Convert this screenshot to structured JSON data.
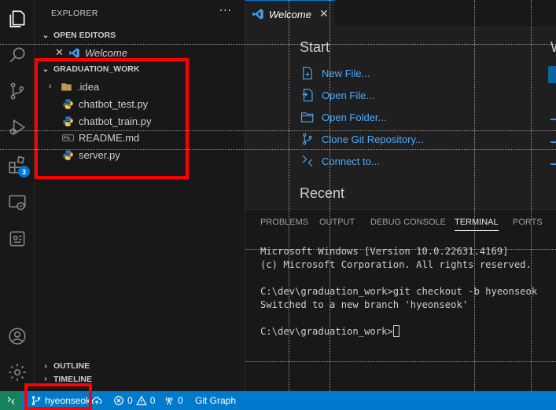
{
  "sidebar": {
    "header": "EXPLORER",
    "more": "···",
    "open_editors": {
      "title": "OPEN EDITORS",
      "items": [
        {
          "label": "Welcome",
          "icon": "vscode-icon"
        }
      ]
    },
    "folder": {
      "title": "GRADUATION_WORK",
      "items": [
        {
          "label": ".idea",
          "icon": "folder-icon"
        },
        {
          "label": "chatbot_test.py",
          "icon": "python-icon"
        },
        {
          "label": "chatbot_train.py",
          "icon": "python-icon"
        },
        {
          "label": "README.md",
          "icon": "markdown-icon"
        },
        {
          "label": "server.py",
          "icon": "python-icon"
        }
      ]
    },
    "outline_title": "OUTLINE",
    "timeline_title": "TIMELINE"
  },
  "activity_bar": {
    "items": [
      "explorer-icon",
      "search-icon",
      "source-control-icon",
      "run-debug-icon",
      "extensions-icon",
      "remote-explorer-icon",
      "copilot-icon"
    ],
    "extensions_badge": "3",
    "bottom": [
      "account-icon",
      "settings-gear-icon"
    ]
  },
  "editor": {
    "tab": {
      "label": "Welcome",
      "close": "✕"
    },
    "welcome": {
      "start_heading": "Start",
      "start_items": [
        {
          "label": "New File...",
          "icon": "new-file-icon"
        },
        {
          "label": "Open File...",
          "icon": "open-file-icon"
        },
        {
          "label": "Open Folder...",
          "icon": "open-folder-icon"
        },
        {
          "label": "Clone Git Repository...",
          "icon": "clone-repo-icon"
        },
        {
          "label": "Connect to...",
          "icon": "remote-connect-icon"
        }
      ],
      "recent_heading": "Recent",
      "partial_heading": "W"
    }
  },
  "panel": {
    "tabs": [
      "PROBLEMS",
      "OUTPUT",
      "DEBUG CONSOLE",
      "TERMINAL",
      "PORTS"
    ],
    "active_tab": "TERMINAL",
    "terminal_lines": [
      "Microsoft Windows [Version 10.0.22631.4169]",
      "(c) Microsoft Corporation. All rights reserved.",
      "",
      "C:\\dev\\graduation_work>git checkout -b hyeonseok",
      "Switched to a new branch 'hyeonseok'",
      "",
      "C:\\dev\\graduation_work>"
    ]
  },
  "statusbar": {
    "branch": "hyeonseok",
    "errors": "0",
    "warnings": "0",
    "ports": "0",
    "git_graph": "Git Graph"
  },
  "colors": {
    "accent": "#007acc",
    "annotation": "#ff0000",
    "link": "#4daafc"
  }
}
